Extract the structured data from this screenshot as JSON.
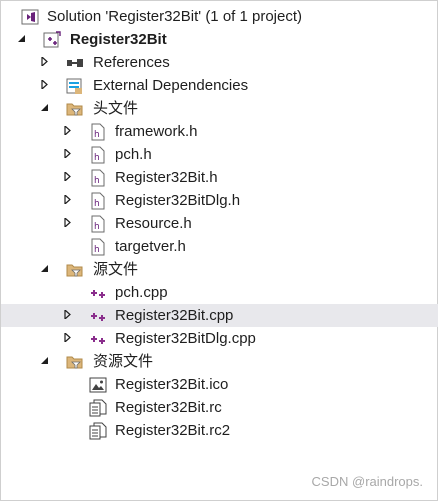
{
  "solution": {
    "label": "Solution 'Register32Bit' (1 of 1 project)"
  },
  "project": {
    "label": "Register32Bit"
  },
  "nodes": {
    "references": "References",
    "external_dependencies": "External Dependencies",
    "header_folder": "头文件",
    "framework_h": "framework.h",
    "pch_h": "pch.h",
    "register32bit_h": "Register32Bit.h",
    "register32bitdlg_h": "Register32BitDlg.h",
    "resource_h": "Resource.h",
    "targetver_h": "targetver.h",
    "source_folder": "源文件",
    "pch_cpp": "pch.cpp",
    "register32bit_cpp": "Register32Bit.cpp",
    "register32bitdlg_cpp": "Register32BitDlg.cpp",
    "resource_folder": "资源文件",
    "register32bit_ico": "Register32Bit.ico",
    "register32bit_rc": "Register32Bit.rc",
    "register32bit_rc2": "Register32Bit.rc2"
  },
  "watermark": "CSDN @raindrops.",
  "colors": {
    "hover_row": "#e8e8ec",
    "vs_purple": "#68217a",
    "folder_yellow": "#dcb67a",
    "cpp_purple": "#8a2d8c"
  }
}
